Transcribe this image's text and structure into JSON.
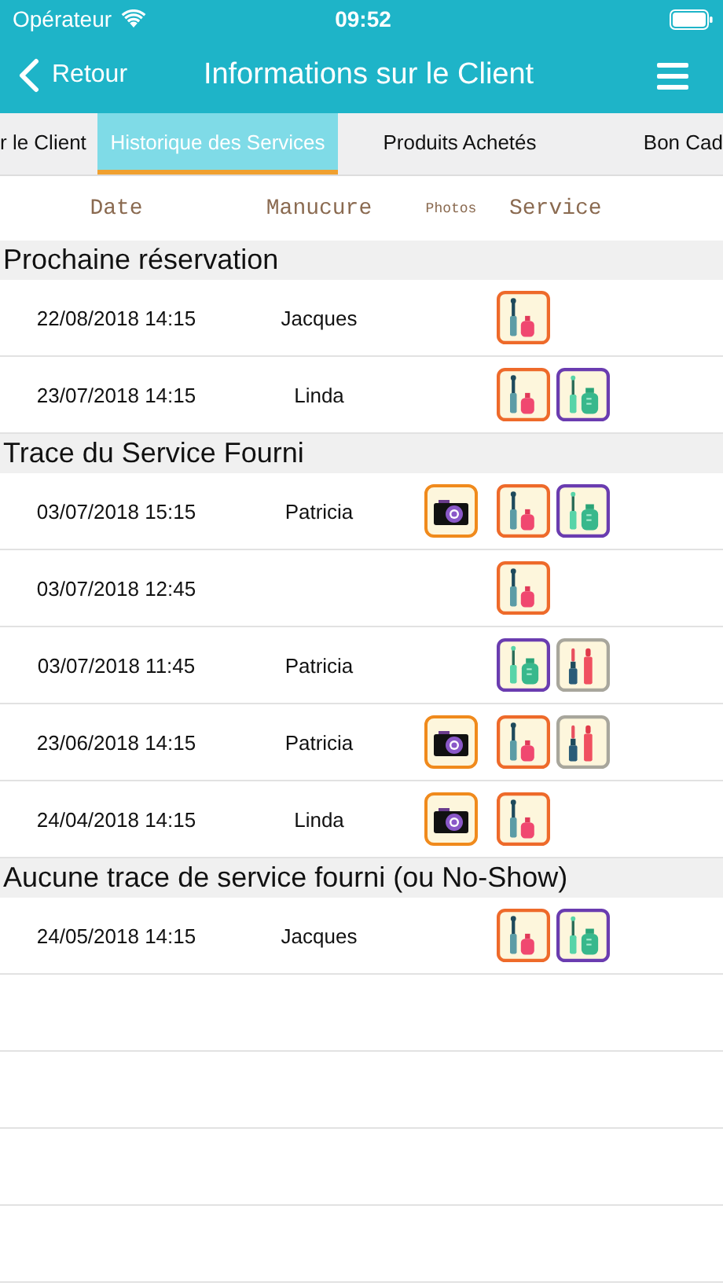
{
  "status_bar": {
    "carrier": "Opérateur",
    "time": "09:52"
  },
  "nav": {
    "back": "Retour",
    "title": "Informations sur le Client"
  },
  "tabs": [
    {
      "label": "r le Client",
      "selected": false
    },
    {
      "label": "Historique des Services",
      "selected": true
    },
    {
      "label": "Produits Achetés",
      "selected": false
    },
    {
      "label": "Bon Cad",
      "selected": false
    }
  ],
  "table": {
    "columns": [
      "Date",
      "Manucure",
      "Photos",
      "Service"
    ],
    "sections": [
      {
        "title": "Prochaine réservation",
        "rows": [
          {
            "date": "22/08/2018 14:15",
            "manucure": "Jacques",
            "photo": false,
            "services": [
              {
                "kind": "polish"
              }
            ]
          },
          {
            "date": "23/07/2018 14:15",
            "manucure": "Linda",
            "photo": false,
            "services": [
              {
                "kind": "polish"
              },
              {
                "kind": "gel"
              }
            ]
          }
        ]
      },
      {
        "title": "Trace du Service Fourni",
        "rows": [
          {
            "date": "03/07/2018 15:15",
            "manucure": "Patricia",
            "photo": true,
            "services": [
              {
                "kind": "polish"
              },
              {
                "kind": "gel"
              }
            ]
          },
          {
            "date": "03/07/2018 12:45",
            "photo": false,
            "services": [
              {
                "kind": "polish"
              }
            ]
          },
          {
            "date": "03/07/2018 11:45",
            "manucure": "Patricia",
            "photo": false,
            "services": [
              {
                "kind": "gel"
              },
              {
                "kind": "lipstick"
              }
            ]
          },
          {
            "date": "23/06/2018 14:15",
            "manucure": "Patricia",
            "photo": true,
            "services": [
              {
                "kind": "polish"
              },
              {
                "kind": "lipstick"
              }
            ]
          },
          {
            "date": "24/04/2018 14:15",
            "manucure": "Linda",
            "photo": true,
            "services": [
              {
                "kind": "polish"
              }
            ]
          }
        ]
      },
      {
        "title": "Aucune trace de service fourni (ou No-Show)",
        "rows": [
          {
            "date": "24/05/2018 14:15",
            "manucure": "Jacques",
            "photo": false,
            "services": [
              {
                "kind": "polish"
              },
              {
                "kind": "gel"
              }
            ]
          }
        ]
      }
    ]
  }
}
